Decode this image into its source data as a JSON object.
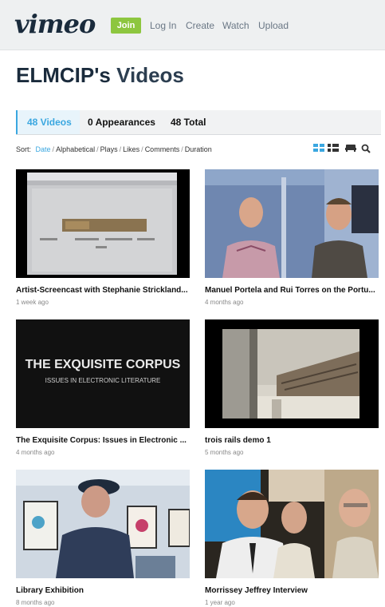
{
  "header": {
    "logo": "vimeo",
    "join_label": "Join",
    "nav": [
      "Log In",
      "Create",
      "Watch",
      "Upload"
    ],
    "brand_color": "#8dc63f"
  },
  "page": {
    "owner": "ELMCIP's",
    "title_rest": " Videos"
  },
  "tabs": [
    {
      "label": "48 Videos",
      "active": true
    },
    {
      "label": "0 Appearances",
      "active": false
    },
    {
      "label": "48 Total",
      "active": false
    }
  ],
  "sort": {
    "label": "Sort:",
    "options": [
      "Date",
      "Alphabetical",
      "Plays",
      "Likes",
      "Comments",
      "Duration"
    ],
    "selected": "Date"
  },
  "view_icons": [
    "grid-large-icon",
    "grid-small-icon",
    "couch-icon",
    "search-icon"
  ],
  "videos": [
    {
      "title": "Artist-Screencast with Stephanie Strickland...",
      "time": "1 week ago",
      "thumb": "screencast-thumbnail",
      "thumb_text": [
        "Stick Counter",
        "Stephanie Strickland",
        "Home"
      ]
    },
    {
      "title": "Manuel Portela and Rui Torres on the Portu...",
      "time": "4 months ago",
      "thumb": "two-men-thumbnail"
    },
    {
      "title": "The Exquisite Corpus: Issues in Electronic ...",
      "time": "4 months ago",
      "thumb": "title-card-thumbnail",
      "thumb_text": [
        "THE EXQUISITE CORPUS",
        "ISSUES IN ELECTRONIC LITERATURE"
      ]
    },
    {
      "title": "trois rails demo 1",
      "time": "5 months ago",
      "thumb": "window-view-thumbnail"
    },
    {
      "title": "Library Exhibition",
      "time": "8 months ago",
      "thumb": "exhibition-thumbnail"
    },
    {
      "title": "Morrissey Jeffrey Interview",
      "time": "1 year ago",
      "thumb": "interview-thumbnail"
    }
  ]
}
